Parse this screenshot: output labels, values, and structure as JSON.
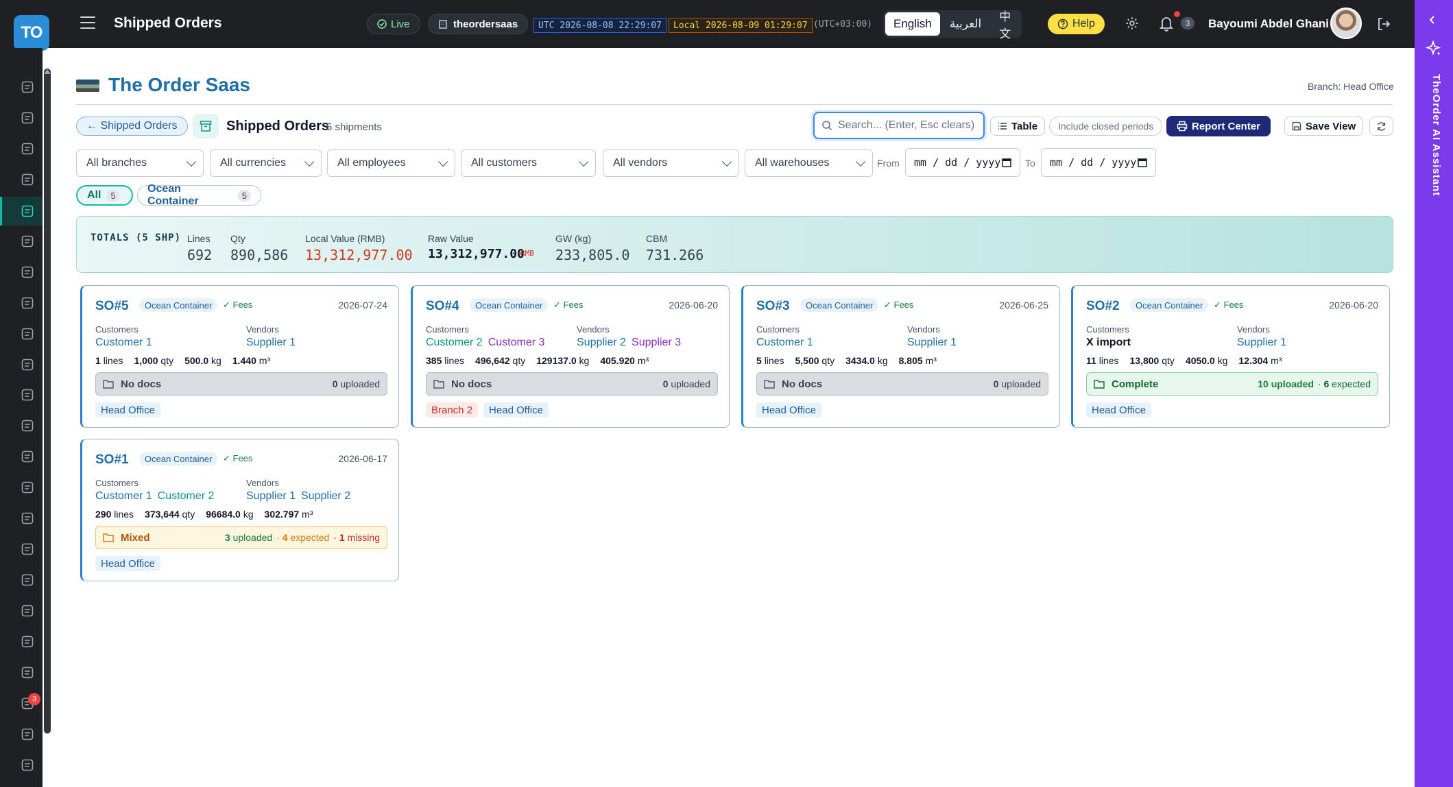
{
  "header": {
    "logo_text": "TO",
    "app_title": "Shipped Orders",
    "live_label": "Live",
    "tenant": "theordersaas",
    "utc_clock": "UTC 2026-08-08 22:29:07",
    "local_clock": "Local 2026-08-09 01:29:07",
    "timezone": "(UTC+03:00)",
    "languages": [
      "English",
      "العربية",
      "中文"
    ],
    "active_language": "English",
    "help_label": "Help",
    "notification_count": "3",
    "user_name": "Bayoumi Abdel Ghani"
  },
  "sidebar": {
    "icons": [
      "dashboard-icon",
      "clipboard-icon",
      "cart-icon",
      "clipboard-check-icon",
      "archive-box-icon",
      "package-icon",
      "layers-icon",
      "users-icon",
      "contact-card-icon",
      "accessibility-icon",
      "car-icon",
      "dollar-doc-icon",
      "wallet-icon",
      "bank-icon",
      "document-icon",
      "book-icon",
      "dollar-icon",
      "bar-chart-icon",
      "coins-icon",
      "inbox-icon",
      "megaphone-icon",
      "user-group-icon",
      "calendar-clock-icon"
    ],
    "active": "archive-box-icon",
    "megaphone_badge": "3"
  },
  "ai_rail": {
    "label": "TheOrder AI Assistant"
  },
  "brand": {
    "title": "The Order Saas",
    "branch_label": "Branch: Head Office"
  },
  "toolbar": {
    "back_label": "← Shipped Orders",
    "page_title": "Shipped Orders",
    "shipment_count": "5 shipments",
    "search_placeholder": "Search... (Enter, Esc clears)",
    "table_label": "Table",
    "closed_label": "Include closed periods",
    "report_label": "Report Center",
    "save_view_label": "Save View"
  },
  "filters": {
    "branches": "All branches",
    "currencies": "All currencies",
    "employees": "All employees",
    "customers": "All customers",
    "vendors": "All vendors",
    "warehouses": "All warehouses",
    "from_label": "From",
    "to_label": "To",
    "date_placeholder": "mm / dd / yyyy"
  },
  "tabs": [
    {
      "label": "All",
      "count": "5"
    },
    {
      "label": "Ocean Container",
      "count": "5"
    }
  ],
  "totals": {
    "heading": "TOTALS (5 SHP)",
    "lines_label": "Lines",
    "lines": "692",
    "qty_label": "Qty",
    "qty": "890,586",
    "local_label": "Local Value (RMB)",
    "local": "13,312,977.00",
    "raw_label": "Raw Value",
    "raw": "13,312,977.00",
    "raw_unit": "RMB",
    "gw_label": "GW (kg)",
    "gw": "233,805.0",
    "cbm_label": "CBM",
    "cbm": "731.266"
  },
  "card_labels": {
    "customers": "Customers",
    "vendors": "Vendors",
    "type": "Ocean Container",
    "fees": "✓ Fees"
  },
  "cards": [
    {
      "so": "SO#5",
      "date": "2026-07-24",
      "customers": [
        "Customer 1"
      ],
      "vendors": [
        "Supplier 1"
      ],
      "lines": "1",
      "qty": "1,000",
      "kg": "500.0",
      "cbm": "1.440",
      "doc_status": "No docs",
      "doc_uploaded": "0",
      "branches": [
        "Head Office"
      ]
    },
    {
      "so": "SO#4",
      "date": "2026-06-20",
      "customers": [
        "Customer 2",
        "Customer 3"
      ],
      "vendors": [
        "Supplier 2",
        "Supplier 3"
      ],
      "lines": "385",
      "qty": "496,642",
      "kg": "129137.0",
      "cbm": "405.920",
      "doc_status": "No docs",
      "doc_uploaded": "0",
      "branches": [
        "Branch 2",
        "Head Office"
      ]
    },
    {
      "so": "SO#3",
      "date": "2026-06-25",
      "customers": [
        "Customer 1"
      ],
      "vendors": [
        "Supplier 1"
      ],
      "lines": "5",
      "qty": "5,500",
      "kg": "3434.0",
      "cbm": "8.805",
      "doc_status": "No docs",
      "doc_uploaded": "0",
      "branches": [
        "Head Office"
      ]
    },
    {
      "so": "SO#2",
      "date": "2026-06-20",
      "customers": [
        "X import"
      ],
      "vendors": [
        "Supplier 1"
      ],
      "lines": "11",
      "qty": "13,800",
      "kg": "4050.0",
      "cbm": "12.304",
      "doc_status": "Complete",
      "doc_uploaded": "10",
      "doc_expected": "6",
      "branches": [
        "Head Office"
      ]
    },
    {
      "so": "SO#1",
      "date": "2026-06-17",
      "customers": [
        "Customer 1",
        "Customer 2"
      ],
      "vendors": [
        "Supplier 1",
        "Supplier 2"
      ],
      "lines": "290",
      "qty": "373,644",
      "kg": "96684.0",
      "cbm": "302.797",
      "doc_status": "Mixed",
      "doc_uploaded": "3",
      "doc_expected": "4",
      "doc_missing": "1",
      "branches": [
        "Head Office"
      ]
    }
  ],
  "units": {
    "lines": "lines",
    "qty": "qty",
    "kg": "kg",
    "cbm": "m³",
    "uploaded": "uploaded",
    "expected": "expected",
    "missing": "missing"
  },
  "colors": {
    "accent": "#1e6fa8",
    "ai_rail": "#7c3aed",
    "teal": "#14b8a6",
    "report_btn": "#1e2a78"
  }
}
